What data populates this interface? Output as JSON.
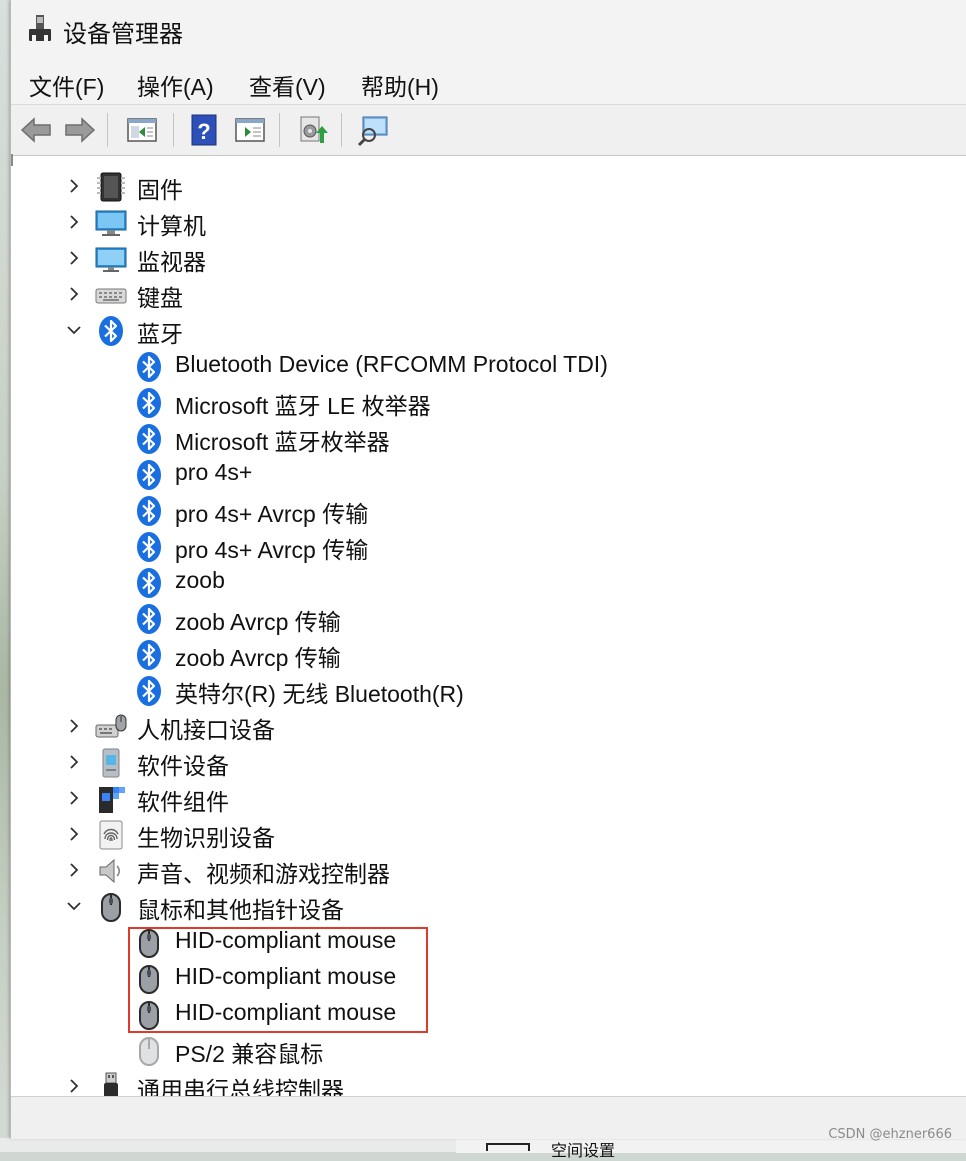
{
  "window": {
    "title": "设备管理器"
  },
  "menu": [
    "文件(F)",
    "操作(A)",
    "查看(V)",
    "帮助(H)"
  ],
  "tree": {
    "rows": [
      {
        "label": "固件",
        "level": 0,
        "state": "collapsed",
        "icon": "firmware-icon"
      },
      {
        "label": "计算机",
        "level": 0,
        "state": "collapsed",
        "icon": "computer-icon"
      },
      {
        "label": "监视器",
        "level": 0,
        "state": "collapsed",
        "icon": "monitor-icon"
      },
      {
        "label": "键盘",
        "level": 0,
        "state": "collapsed",
        "icon": "keyboard-icon"
      },
      {
        "label": "蓝牙",
        "level": 0,
        "state": "expanded",
        "icon": "bluetooth-icon"
      },
      {
        "label": "Bluetooth Device (RFCOMM Protocol TDI)",
        "level": 1,
        "icon": "bluetooth-icon"
      },
      {
        "label": "Microsoft 蓝牙 LE 枚举器",
        "level": 1,
        "icon": "bluetooth-icon"
      },
      {
        "label": "Microsoft 蓝牙枚举器",
        "level": 1,
        "icon": "bluetooth-icon"
      },
      {
        "label": "pro 4s+",
        "level": 1,
        "icon": "bluetooth-icon"
      },
      {
        "label": "pro 4s+ Avrcp 传输",
        "level": 1,
        "icon": "bluetooth-icon"
      },
      {
        "label": "pro 4s+ Avrcp 传输",
        "level": 1,
        "icon": "bluetooth-icon"
      },
      {
        "label": "zoob",
        "level": 1,
        "icon": "bluetooth-icon"
      },
      {
        "label": "zoob Avrcp 传输",
        "level": 1,
        "icon": "bluetooth-icon"
      },
      {
        "label": "zoob Avrcp 传输",
        "level": 1,
        "icon": "bluetooth-icon"
      },
      {
        "label": "英特尔(R) 无线 Bluetooth(R)",
        "level": 1,
        "icon": "bluetooth-icon"
      },
      {
        "label": "人机接口设备",
        "level": 0,
        "state": "collapsed",
        "icon": "hid-icon"
      },
      {
        "label": "软件设备",
        "level": 0,
        "state": "collapsed",
        "icon": "software-device-icon"
      },
      {
        "label": "软件组件",
        "level": 0,
        "state": "collapsed",
        "icon": "software-component-icon"
      },
      {
        "label": "生物识别设备",
        "level": 0,
        "state": "collapsed",
        "icon": "fingerprint-icon"
      },
      {
        "label": "声音、视频和游戏控制器",
        "level": 0,
        "state": "collapsed",
        "icon": "speaker-icon"
      },
      {
        "label": "鼠标和其他指针设备",
        "level": 0,
        "state": "expanded",
        "icon": "mouse-icon"
      },
      {
        "label": "HID-compliant mouse",
        "level": 1,
        "icon": "mouse-icon"
      },
      {
        "label": "HID-compliant mouse",
        "level": 1,
        "icon": "mouse-icon"
      },
      {
        "label": "HID-compliant mouse",
        "level": 1,
        "icon": "mouse-icon"
      },
      {
        "label": "PS/2 兼容鼠标",
        "level": 1,
        "icon": "mouse-disabled-icon"
      },
      {
        "label": "通用串行总线控制器",
        "level": 0,
        "state": "collapsed",
        "icon": "usb-icon"
      }
    ]
  },
  "background_window": {
    "text": "空间设置"
  },
  "watermark": "CSDN @ehzner666",
  "colors": {
    "highlight_box": "#e03b2a",
    "bluetooth_blue": "#1a6fe0"
  }
}
